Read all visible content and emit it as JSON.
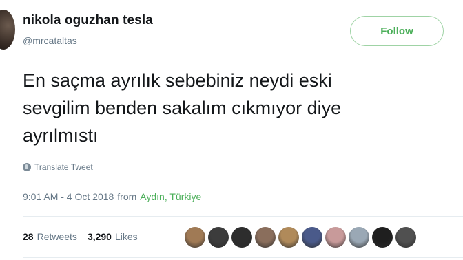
{
  "tweet": {
    "author_name": "nikola oguzhan tesla",
    "author_handle": "@mrcataltas",
    "follow_label": "Follow",
    "text": "En saçma ayrılık sebebiniz neydi eski\nsevgilim benden sakalım cıkmıyor diye\nayrılmıstı",
    "translate_label": "Translate Tweet",
    "timestamp": "9:01 AM - 4 Oct 2018",
    "from_label": "from",
    "location": "Aydın, Türkiye",
    "retweets_count": "28",
    "retweets_label": "Retweets",
    "likes_count": "3,290",
    "likes_label": "Likes"
  },
  "colors": {
    "accent_green": "#4caf5a",
    "text_dark": "#14171a",
    "text_muted": "#657786",
    "liker_avatars": [
      "#a07a55",
      "#3c3c3c",
      "#2d2d2d",
      "#8a6e5c",
      "#b08a5a",
      "#4a5a8a",
      "#c89a9a",
      "#9aa8b5",
      "#1f1f1f",
      "#505050"
    ]
  }
}
